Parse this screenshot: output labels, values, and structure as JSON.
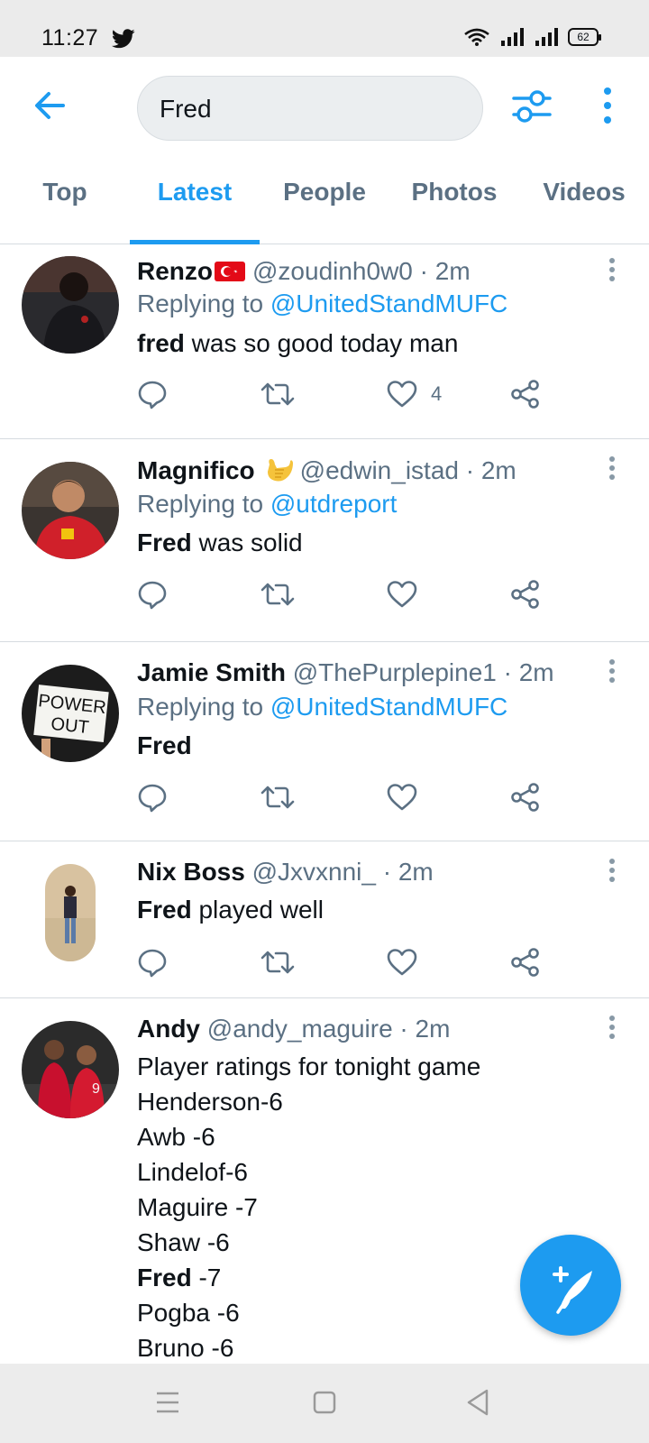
{
  "status_bar": {
    "time": "11:27",
    "battery": "62"
  },
  "search": {
    "query": "Fred"
  },
  "tabs": [
    {
      "label": "Top"
    },
    {
      "label": "Latest"
    },
    {
      "label": "People"
    },
    {
      "label": "Photos"
    },
    {
      "label": "Videos"
    }
  ],
  "active_tab": "Latest",
  "tweets": [
    {
      "name": "Renzo",
      "handle": "@zoudinh0w0 · 2m",
      "replying_prefix": "Replying to ",
      "replying_to": "@UnitedStandMUFC",
      "text_bold": "fred",
      "text_rest": " was so good today man",
      "like_count": "4"
    },
    {
      "name": "Magnifico",
      "handle": "@edwin_istad · 2m",
      "replying_prefix": "Replying to ",
      "replying_to": "@utdreport",
      "text_bold": "Fred",
      "text_rest": " was solid"
    },
    {
      "name": "Jamie Smith",
      "handle": "@ThePurplepine1 · 2m",
      "replying_prefix": "Replying to ",
      "replying_to": "@UnitedStandMUFC",
      "text_bold": "Fred",
      "text_rest": "",
      "avatar_text_1": "POWER",
      "avatar_text_2": "OUT"
    },
    {
      "name": "Nix Boss",
      "handle": "@Jxvxnni_ · 2m",
      "text_bold": "Fred",
      "text_rest": " played well"
    },
    {
      "name": "Andy",
      "handle": "@andy_maguire · 2m",
      "lines": [
        "Player ratings for tonight game",
        "Henderson-6",
        "Awb -6",
        "Lindelof-6",
        "Maguire -7",
        "Shaw -6",
        "Pogba -6",
        "Bruno -6"
      ],
      "fred_bold": "Fred",
      "fred_rest": " -7"
    }
  ],
  "colors": {
    "accent": "#1d9bf0",
    "secondary_text": "#5b7083",
    "primary_text": "#0f1419"
  }
}
